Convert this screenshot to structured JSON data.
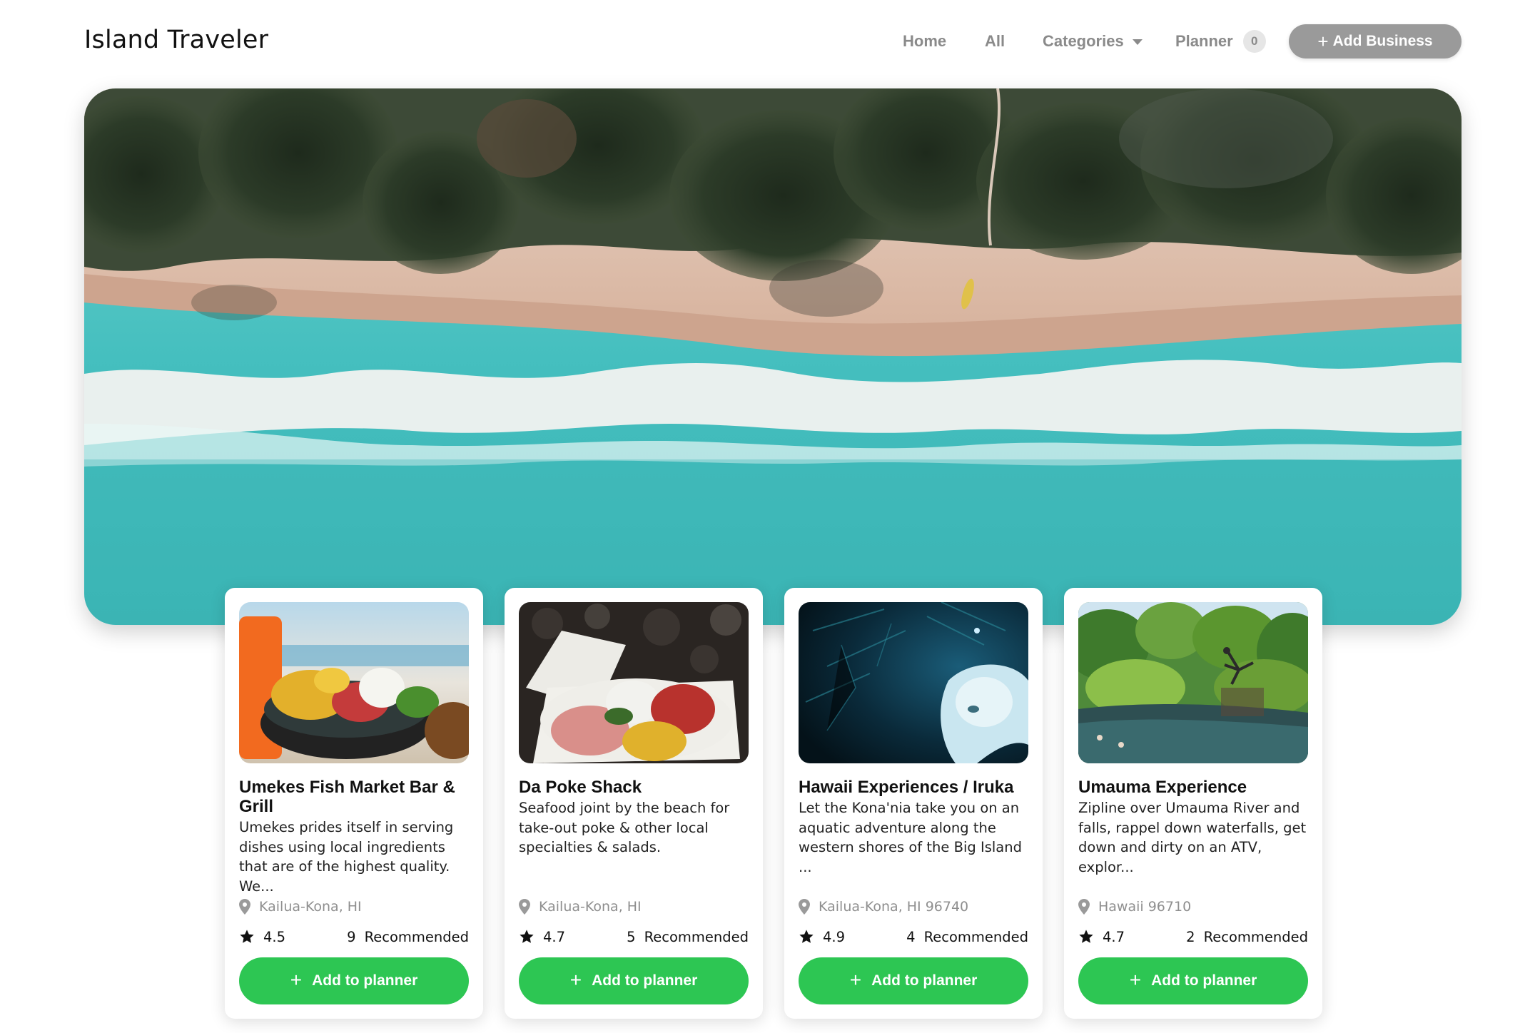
{
  "header": {
    "brand": "Island Traveler",
    "nav": {
      "home": "Home",
      "all": "All",
      "categories": "Categories",
      "planner": "Planner",
      "planner_count": "0"
    },
    "add_business_icon": "+",
    "add_business": "Add Business"
  },
  "hero": {
    "image": "aerial beach with palm trees, sand, and turquoise ocean"
  },
  "colors": {
    "accent_green": "#2dc653",
    "button_gray": "#9a9a9a",
    "muted_text": "#8a8a8a"
  },
  "cards": [
    {
      "image": "poke bowl with sushi rice and fish",
      "title": "Umekes Fish Market Bar & Grill",
      "description": "Umekes prides itself in serving dishes using local ingredients that are of the highest quality. We...",
      "location": "Kailua-Kona, HI",
      "rating": "4.5",
      "recommended_count": "9",
      "recommended_label": "Recommended",
      "button_icon": "+",
      "button_label": "Add to planner"
    },
    {
      "image": "take-out poke container on lava rocks",
      "title": "Da Poke Shack",
      "description": "Seafood joint by the beach for take-out poke & other local specialties & salads.",
      "location": "Kailua-Kona, HI",
      "rating": "4.7",
      "recommended_count": "5",
      "recommended_label": "Recommended",
      "button_icon": "+",
      "button_label": "Add to planner"
    },
    {
      "image": "manta ray underwater at night",
      "title": "Hawaii Experiences / Iruka",
      "description": "Let the Kona'nia take you on an aquatic adventure along the western shores of the Big Island ...",
      "location": "Kailua-Kona, HI 96740",
      "rating": "4.9",
      "recommended_count": "4",
      "recommended_label": "Recommended",
      "button_icon": "+",
      "button_label": "Add to planner"
    },
    {
      "image": "person jumping into a jungle river pool",
      "title": "Umauma Experience",
      "description": "Zipline over Umauma River and falls, rappel down waterfalls, get down and dirty on an ATV, explor...",
      "location": "Hawaii 96710",
      "rating": "4.7",
      "recommended_count": "2",
      "recommended_label": "Recommended",
      "button_icon": "+",
      "button_label": "Add to planner"
    }
  ]
}
